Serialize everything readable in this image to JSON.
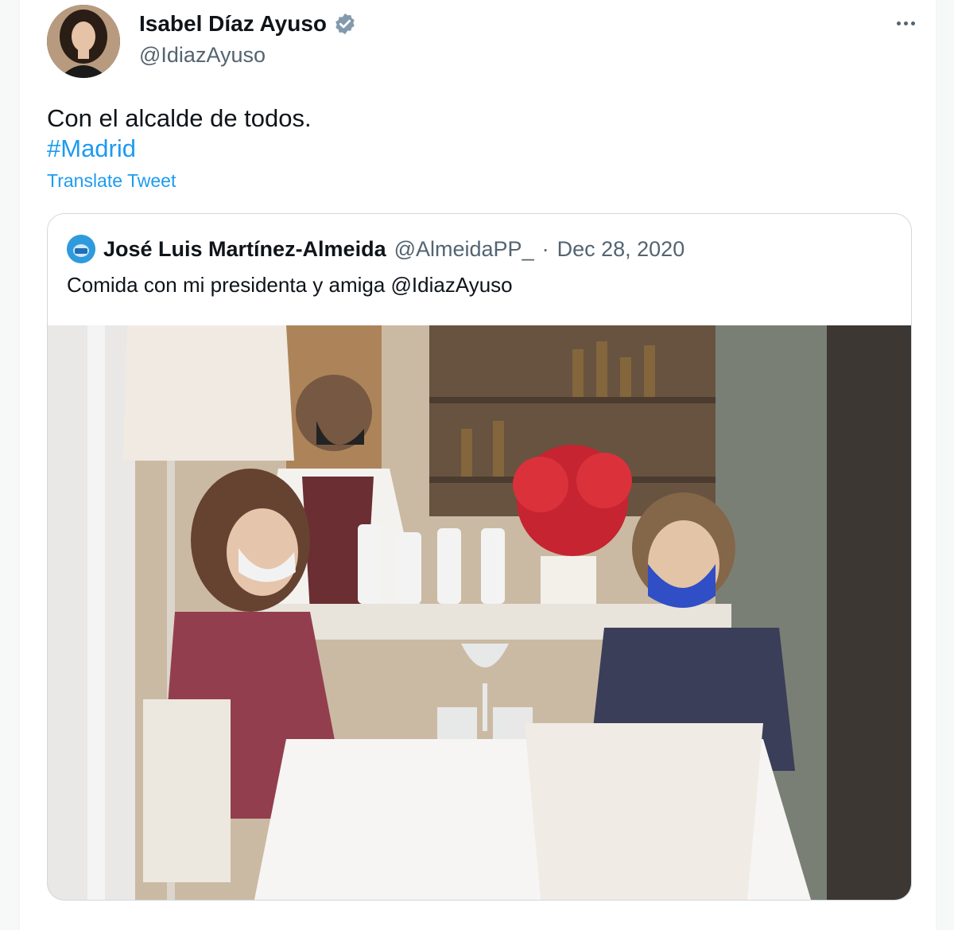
{
  "tweet": {
    "author_name": "Isabel Díaz Ayuso",
    "author_handle": "@IdiazAyuso",
    "text_line1": "Con el alcalde de todos.",
    "hashtag": "#Madrid",
    "translate_label": "Translate Tweet",
    "more_icon": "more-icon",
    "verified_icon": "verified-badge-icon"
  },
  "quoted": {
    "author_name": "José Luis Martínez-Almeida",
    "author_handle": "@AlmeidaPP_",
    "separator": "·",
    "date": "Dec 28, 2020",
    "text": "Comida con mi presidenta y amiga @IdiazAyuso"
  },
  "colors": {
    "link": "#1d9bf0",
    "secondary_text": "#536471",
    "primary_text": "#0f1419",
    "border": "#cfd9de"
  }
}
